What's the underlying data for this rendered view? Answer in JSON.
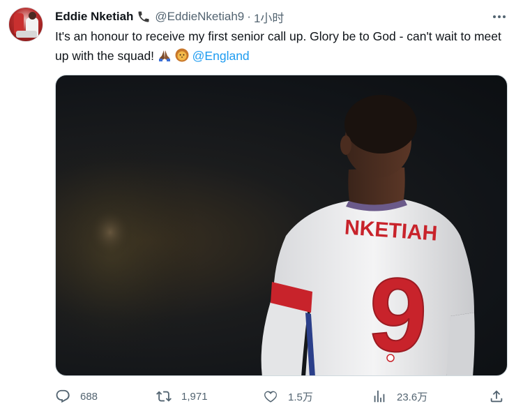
{
  "tweet": {
    "display_name": "Eddie Nketiah",
    "handle": "@EddieNketiah9",
    "separator": "·",
    "time": "1小时",
    "text_main": "It's an honour to receive my first senior call up. Glory be to God - can't wait to meet up with the squad!",
    "mention": "@England",
    "emojis": [
      "folded-hands-icon",
      "lion-face-icon"
    ]
  },
  "media": {
    "jersey_name": "NKETIAH",
    "jersey_number": "9"
  },
  "actions": {
    "replies": "688",
    "retweets": "1,971",
    "likes": "1.5万",
    "views": "23.6万"
  },
  "icons": {
    "name_badge": "phone-icon",
    "more": "more-icon",
    "reply": "reply-icon",
    "retweet": "retweet-icon",
    "like": "like-icon",
    "views": "views-icon",
    "share": "share-icon"
  },
  "colors": {
    "link": "#1d9bf0",
    "secondary_text": "#536471",
    "jersey_red": "#c8232b"
  }
}
